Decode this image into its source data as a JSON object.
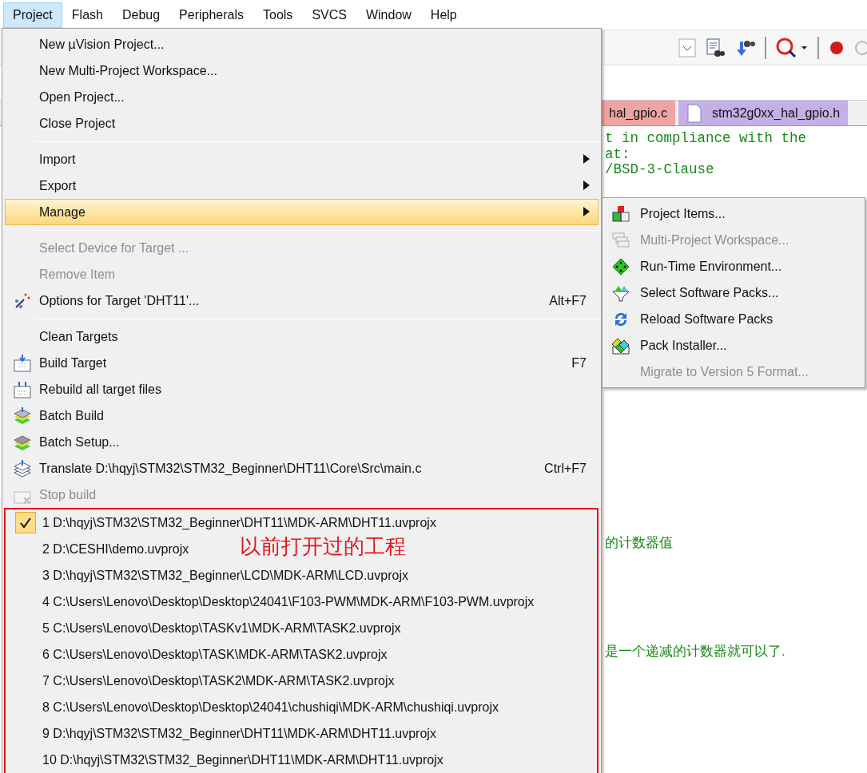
{
  "menubar": [
    {
      "label": "Project",
      "selected": true
    },
    {
      "label": "Flash",
      "selected": false
    },
    {
      "label": "Debug",
      "selected": false
    },
    {
      "label": "Peripherals",
      "selected": false
    },
    {
      "label": "Tools",
      "selected": false
    },
    {
      "label": "SVCS",
      "selected": false
    },
    {
      "label": "Window",
      "selected": false
    },
    {
      "label": "Help",
      "selected": false
    }
  ],
  "editor_tabs": [
    {
      "label": "hal_gpio.c",
      "color": "#f0a3a3"
    },
    {
      "label": "stm32g0xx_hal_gpio.h",
      "color": "#c4b0e6"
    }
  ],
  "code_top": [
    "t in compliance with the",
    "at:",
    "/BSD-3-Clause"
  ],
  "code_bottom": [
    "的计数器值",
    "是一个递减的计数器就可以了."
  ],
  "project_menu": {
    "groups": [
      [
        {
          "label": "New µVision Project...",
          "disabled": false,
          "selected": false
        },
        {
          "label": "New Multi-Project Workspace...",
          "disabled": false,
          "selected": false
        },
        {
          "label": "Open Project...",
          "disabled": false,
          "selected": false
        },
        {
          "label": "Close Project",
          "disabled": false,
          "selected": false
        }
      ],
      [
        {
          "label": "Import",
          "submenu": true,
          "disabled": false,
          "selected": false
        },
        {
          "label": "Export",
          "submenu": true,
          "disabled": false,
          "selected": false
        },
        {
          "label": "Manage",
          "submenu": true,
          "disabled": false,
          "selected": true
        }
      ],
      [
        {
          "label": "Select Device for Target ...",
          "disabled": true,
          "selected": false
        },
        {
          "label": "Remove Item",
          "disabled": true,
          "selected": false
        },
        {
          "label": "Options for Target 'DHT11'...",
          "shortcut": "Alt+F7",
          "disabled": false,
          "selected": false
        }
      ],
      [
        {
          "label": "Clean Targets",
          "disabled": false,
          "selected": false
        },
        {
          "label": "Build Target",
          "shortcut": "F7",
          "disabled": false,
          "selected": false
        },
        {
          "label": "Rebuild all target files",
          "disabled": false,
          "selected": false
        },
        {
          "label": "Batch Build",
          "disabled": false,
          "selected": false
        },
        {
          "label": "Batch Setup...",
          "disabled": false,
          "selected": false
        },
        {
          "label": "Translate D:\\hqyj\\STM32\\STM32_Beginner\\DHT11\\Core\\Src\\main.c",
          "shortcut": "Ctrl+F7",
          "disabled": false,
          "selected": false
        },
        {
          "label": "Stop build",
          "disabled": true,
          "selected": false
        }
      ]
    ],
    "recent_projects": [
      {
        "label": "1 D:\\hqyj\\STM32\\STM32_Beginner\\DHT11\\MDK-ARM\\DHT11.uvprojx",
        "checked": true
      },
      {
        "label": "2 D:\\CESHI\\demo.uvprojx",
        "checked": false
      },
      {
        "label": "3 D:\\hqyj\\STM32\\STM32_Beginner\\LCD\\MDK-ARM\\LCD.uvprojx",
        "checked": false
      },
      {
        "label": "4 C:\\Users\\Lenovo\\Desktop\\Desktop\\24041\\F103-PWM\\MDK-ARM\\F103-PWM.uvprojx",
        "checked": false
      },
      {
        "label": "5 C:\\Users\\Lenovo\\Desktop\\TASKv1\\MDK-ARM\\TASK2.uvprojx",
        "checked": false
      },
      {
        "label": "6 C:\\Users\\Lenovo\\Desktop\\TASK\\MDK-ARM\\TASK2.uvprojx",
        "checked": false
      },
      {
        "label": "7 C:\\Users\\Lenovo\\Desktop\\TASK2\\MDK-ARM\\TASK2.uvprojx",
        "checked": false
      },
      {
        "label": "8 C:\\Users\\Lenovo\\Desktop\\Desktop\\24041\\chushiqi\\MDK-ARM\\chushiqi.uvprojx",
        "checked": false
      },
      {
        "label": "9 D:\\hqyj\\STM32\\STM32_Beginner\\DHT11\\MDK-ARM\\DHT11.uvprojx",
        "checked": false
      },
      {
        "label": "10 D:\\hqyj\\STM32\\STM32_Beginner\\DHT11\\MDK-ARM\\DHT11.uvprojx",
        "checked": false
      }
    ]
  },
  "annotation": {
    "text": "以前打开过的工程"
  },
  "manage_submenu": {
    "items": [
      {
        "label": "Project Items...",
        "disabled": false
      },
      {
        "label": "Multi-Project Workspace...",
        "disabled": true
      },
      {
        "label": "Run-Time Environment...",
        "disabled": false
      },
      {
        "label": "Select Software Packs...",
        "disabled": false
      },
      {
        "label": "Reload Software Packs",
        "disabled": false
      },
      {
        "label": "Pack Installer...",
        "disabled": false
      },
      {
        "label": "Migrate to Version 5 Format...",
        "disabled": true
      }
    ]
  }
}
